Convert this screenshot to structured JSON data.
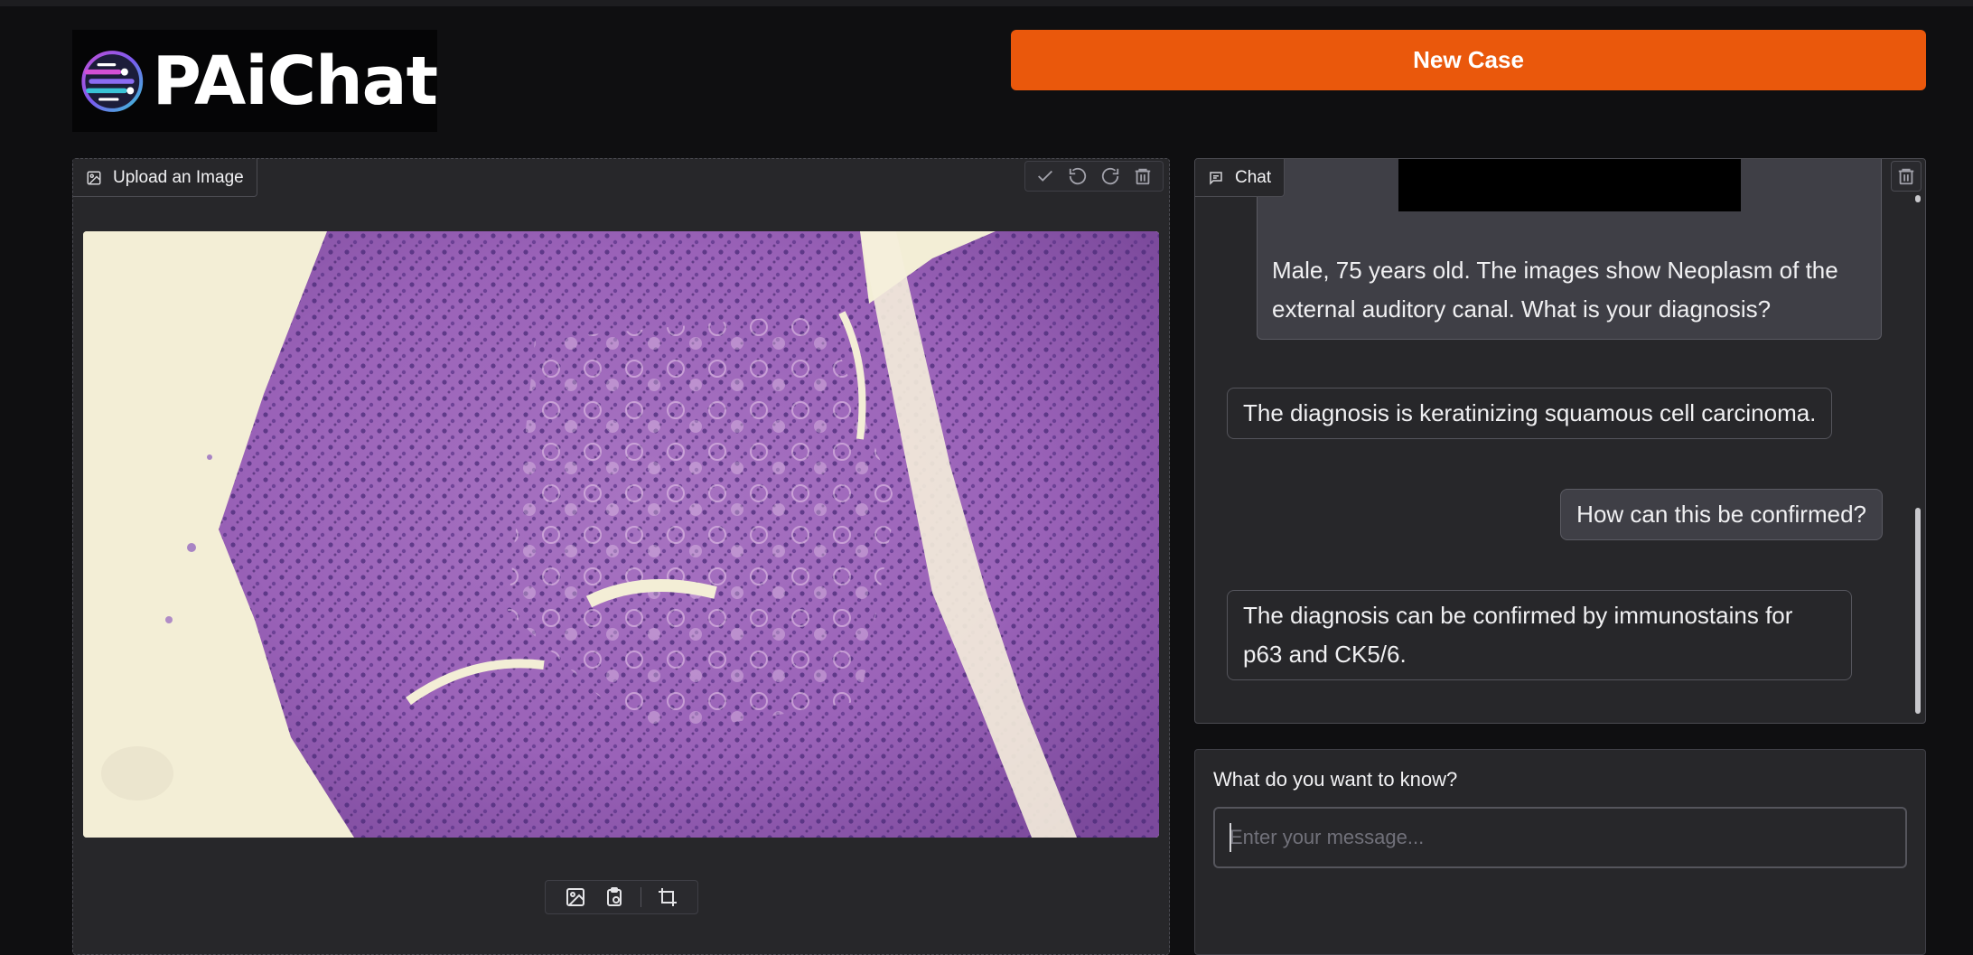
{
  "app": {
    "logo_text": "PAiChat"
  },
  "header": {
    "new_case_label": "New Case"
  },
  "image_panel": {
    "label": "Upload an Image",
    "label_icon": "image-icon",
    "tools": [
      "check-icon",
      "undo-icon",
      "redo-icon",
      "trash-icon"
    ],
    "sources": [
      "image-upload-icon",
      "clipboard-icon",
      "crop-icon"
    ]
  },
  "chat_panel": {
    "label": "Chat",
    "label_icon": "chat-icon",
    "messages": [
      {
        "role": "user",
        "text": "Male, 75 years old. The images show Neoplasm of the external auditory canal. What is your diagnosis?"
      },
      {
        "role": "assistant",
        "text": "The diagnosis is keratinizing squamous cell carcinoma."
      },
      {
        "role": "user",
        "text": "How can this be confirmed?"
      },
      {
        "role": "assistant",
        "text": "The diagnosis can be confirmed by immunostains for p63 and CK5/6."
      }
    ]
  },
  "input_panel": {
    "label": "What do you want to know?",
    "value": "",
    "placeholder": "Enter your message..."
  },
  "colors": {
    "accent": "#ea580c",
    "background": "#0f0f11",
    "panel": "#27272a"
  }
}
